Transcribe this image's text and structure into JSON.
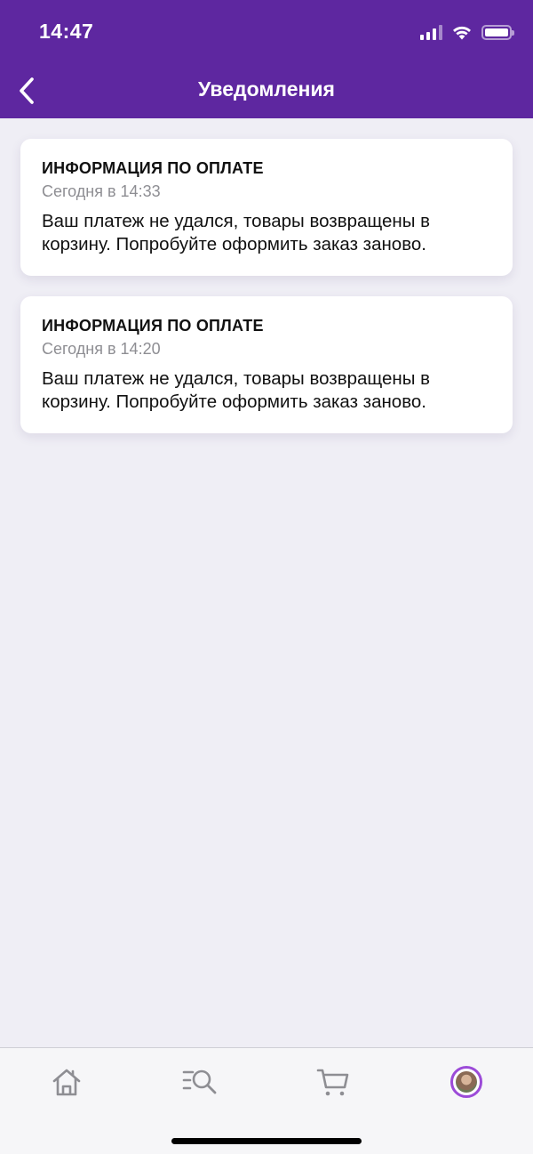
{
  "status_bar": {
    "time": "14:47"
  },
  "header": {
    "title": "Уведомления",
    "back_icon": "chevron-left-icon",
    "background": "#5e27a0"
  },
  "notifications": [
    {
      "title": "ИНФОРМАЦИЯ ПО ОПЛАТЕ",
      "time": "Сегодня в 14:33",
      "text": "Ваш платеж не удался, товары возвращены в корзину. Попробуйте оформить заказ заново."
    },
    {
      "title": "ИНФОРМАЦИЯ ПО ОПЛАТЕ",
      "time": "Сегодня в 14:20",
      "text": "Ваш платеж не удался, товары возвращены в корзину. Попробуйте оформить заказ заново."
    }
  ],
  "tab_bar": {
    "tabs": [
      {
        "icon": "home-icon"
      },
      {
        "icon": "catalog-search-icon"
      },
      {
        "icon": "cart-icon"
      },
      {
        "icon": "profile-avatar-icon"
      }
    ],
    "active_accent": "#9c4bd8"
  }
}
